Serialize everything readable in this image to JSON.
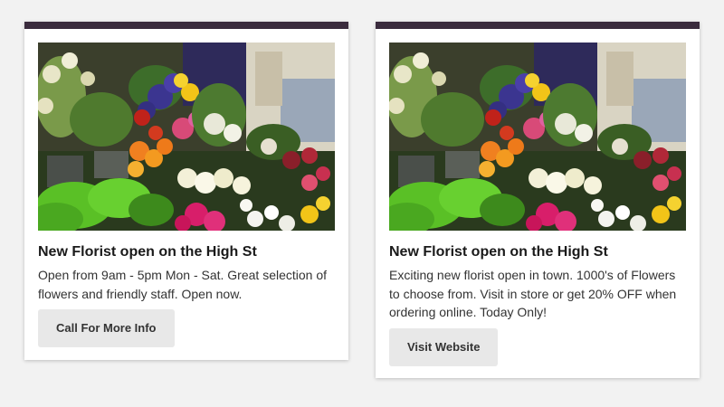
{
  "cards": [
    {
      "image_icon": "flower-shop-photo",
      "title": "New Florist open on the High St",
      "description": "Open from 9am - 5pm Mon - Sat. Great selection of flowers and friendly staff. Open now.",
      "button_label": "Call For More Info"
    },
    {
      "image_icon": "flower-shop-photo",
      "title": "New Florist open on the High St",
      "description": "Exciting new florist open in town. 1000's of Flowers to choose from. Visit in store or get 20% OFF when ordering online. Today Only!",
      "button_label": "Visit Website"
    }
  ],
  "colors": {
    "page_background": "#f2f2f2",
    "card_top_bar": "#3a2b3d",
    "button_background": "#e8e8e8"
  }
}
